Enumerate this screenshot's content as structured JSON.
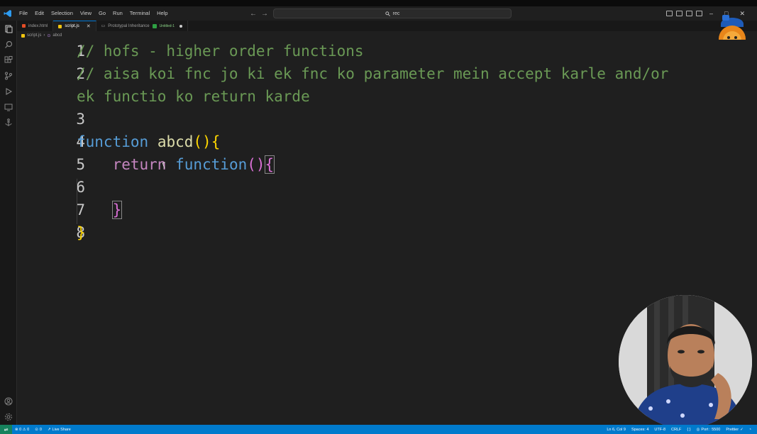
{
  "titlebar": {
    "menu": [
      "File",
      "Edit",
      "Selection",
      "View",
      "Go",
      "Run",
      "Terminal",
      "Help"
    ],
    "search_text": "rec"
  },
  "tabs": [
    {
      "label": "index.html",
      "icon": "html-file-icon",
      "color": "#e44d26",
      "active": false
    },
    {
      "label": "script.js",
      "icon": "js-file-icon",
      "color": "#f1c40f",
      "active": true
    },
    {
      "label": "Prototypal Inheritance",
      "icon": "file-icon",
      "color": "#9d9d9d",
      "active": false,
      "badge": "Untitled-1"
    }
  ],
  "breadcrumb": {
    "file": "script.js",
    "symbol": "abcd"
  },
  "editor": {
    "line_numbers": [
      "1",
      "2",
      "",
      "3",
      "4",
      "5",
      "6",
      "7",
      "8"
    ],
    "line1": "// hofs - higher order functions",
    "line2": "// aisa koi fnc jo ki ek fnc ko parameter mein accept karle and/or",
    "line2_wrap": "ek functio ko return karde",
    "line4_kw": "function",
    "line4_name": "abcd",
    "line4_parens": "()",
    "line4_brace": "{",
    "line5_return": "return",
    "line5_kw": "function",
    "line5_parens": "()",
    "line5_brace": "{",
    "line7_brace": "}",
    "line8_brace": "}"
  },
  "statusbar": {
    "problems": "⊗ 0 ⚠ 0",
    "ports": "0",
    "live_share": "Live Share",
    "position": "Ln 6, Col 9",
    "spaces": "Spaces: 4",
    "encoding": "UTF-8",
    "eol": "CRLF",
    "port": "Port : 5500",
    "prettier": "Prettier"
  },
  "colors": {
    "accent": "#007acc",
    "comment": "#6a9955",
    "keyword": "#569cd6",
    "function_name": "#dcdcaa",
    "bracket_gold": "#ffd700",
    "bracket_purple": "#da70d6"
  }
}
